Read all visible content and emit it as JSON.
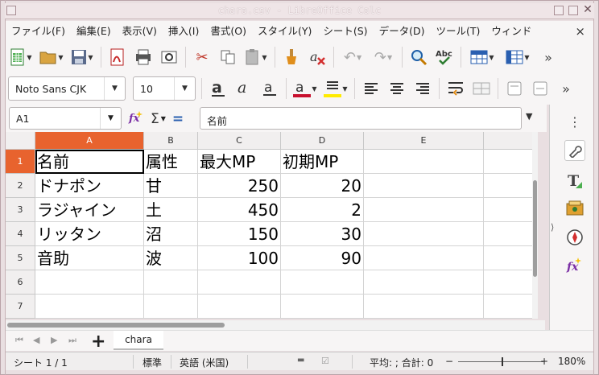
{
  "window": {
    "title": "chara.csv - LibreOffice Calc"
  },
  "menu": [
    "ファイル(F)",
    "編集(E)",
    "表示(V)",
    "挿入(I)",
    "書式(O)",
    "スタイル(Y)",
    "シート(S)",
    "データ(D)",
    "ツール(T)",
    "ウィンド"
  ],
  "menu_close": "×",
  "font": {
    "name": "Noto Sans CJK",
    "size": "10"
  },
  "formula_bar": {
    "cell_ref": "A1",
    "content": "名前",
    "sigma": "Σ",
    "equals": "="
  },
  "sidebar_menu": "⋮",
  "columns": [
    "A",
    "B",
    "C",
    "D",
    "E"
  ],
  "rows": [
    "1",
    "2",
    "3",
    "4",
    "5",
    "6",
    "7"
  ],
  "cells": {
    "r1": [
      "名前",
      "属性",
      "最大MP",
      "初期MP"
    ],
    "r2": [
      "ドナポン",
      "甘",
      "250",
      "20"
    ],
    "r3": [
      "ラジャイン",
      "土",
      "450",
      "2"
    ],
    "r4": [
      "リッタン",
      "沼",
      "150",
      "30"
    ],
    "r5": [
      "音助",
      "波",
      "100",
      "90"
    ]
  },
  "sheet_tab": "chara",
  "add_sheet": "+",
  "status": {
    "sheet": "シート 1 / 1",
    "style": "標準",
    "language": "英語 (米国)",
    "summary": "平均: ; 合計: 0",
    "zoom": "180%",
    "zoom_minus": "−",
    "zoom_plus": "+"
  }
}
